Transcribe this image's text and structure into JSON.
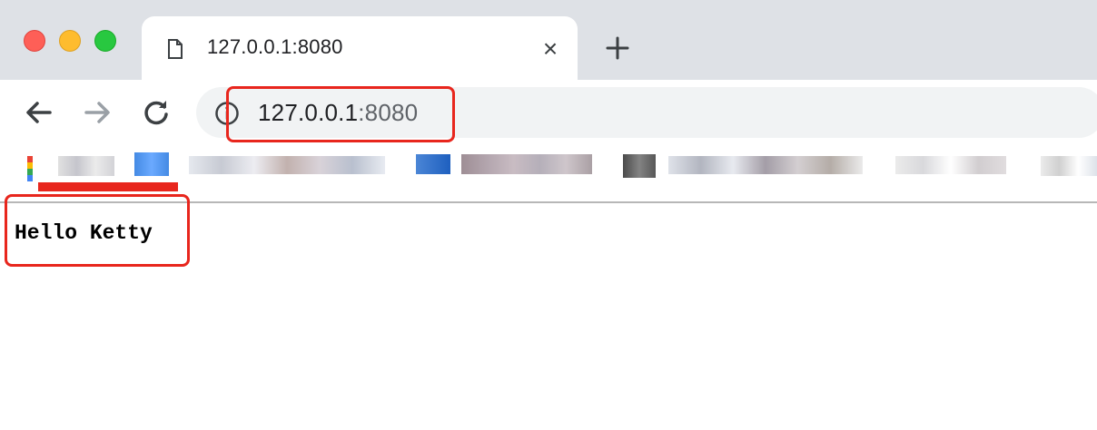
{
  "tab": {
    "title": "127.0.0.1:8080",
    "close_glyph": "×"
  },
  "address_bar": {
    "host": "127.0.0.1",
    "port": ":8080"
  },
  "page": {
    "text": "Hello Ketty"
  },
  "icons": [
    "page-icon",
    "close-icon",
    "plus-icon",
    "back-arrow-icon",
    "forward-arrow-icon",
    "reload-icon",
    "info-icon"
  ],
  "colors": {
    "highlight": "#e8261d",
    "titlebar": "#dee1e6",
    "omnibox": "#f1f3f4"
  }
}
